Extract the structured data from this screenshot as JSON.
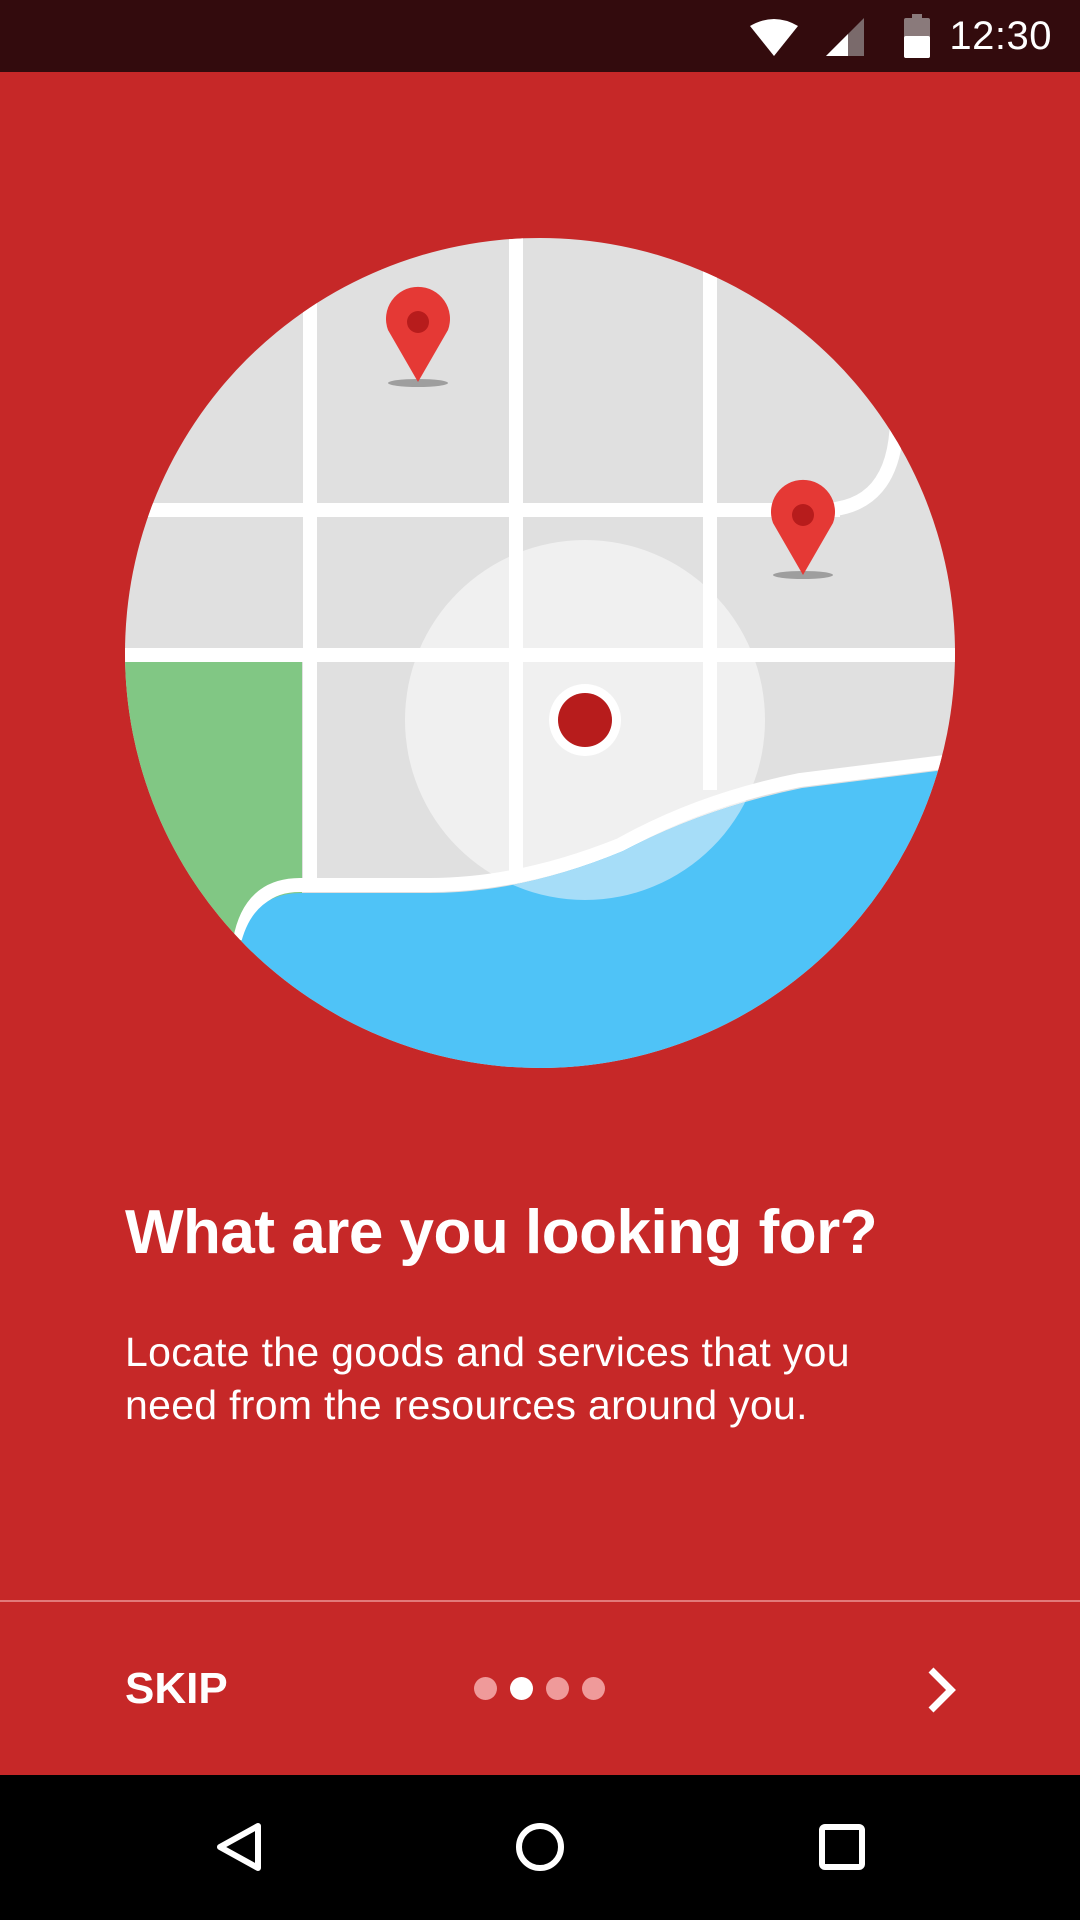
{
  "status_bar": {
    "time": "12:30",
    "icons": [
      "wifi-icon",
      "cellular-signal-icon",
      "battery-icon"
    ]
  },
  "onboarding": {
    "illustration": "map-illustration",
    "title": "What are you looking for?",
    "description": "Locate the goods and services that you need from the resources around you.",
    "page_count": 4,
    "current_page": 2
  },
  "bottom_bar": {
    "skip_label": "SKIP",
    "next_icon": "chevron-right-icon"
  },
  "nav_bar": {
    "icons": [
      "back-triangle-icon",
      "home-circle-icon",
      "recents-square-icon"
    ]
  },
  "colors": {
    "background": "#C62828",
    "status_bar": "#330B0D",
    "map_land": "#E0E0E0",
    "map_park": "#81C784",
    "map_water": "#4FC3F7",
    "pin": "#E53935",
    "dot_active": "#FFFFFF",
    "dot_inactive": "#EF9A9A"
  }
}
